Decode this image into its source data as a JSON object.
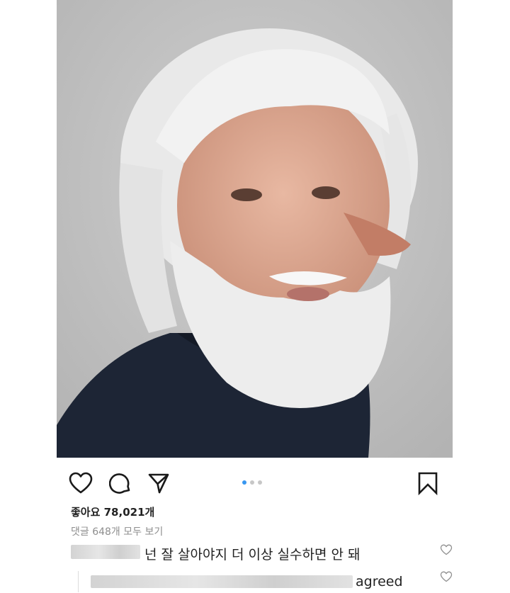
{
  "post": {
    "image_alt": "Portrait photo of an elderly man with white hair and beard",
    "colors": {
      "accent": "#3897f0",
      "muted": "#8e8e8e",
      "text": "#222222"
    }
  },
  "actions": {
    "like_icon": "heart-icon",
    "comment_icon": "comment-icon",
    "share_icon": "send-icon",
    "save_icon": "bookmark-icon"
  },
  "carousel": {
    "total": 3,
    "active": 1
  },
  "likes": {
    "text": "좋아요 78,021개"
  },
  "comments": {
    "view_all": "댓글 648개 모두 보기",
    "items": [
      {
        "text": "넌 잘 살아야지 더 이상 실수하면 안 돼",
        "heart_icon": "heart-outline-icon"
      },
      {
        "text": "agreed",
        "heart_icon": "heart-outline-icon"
      }
    ]
  }
}
